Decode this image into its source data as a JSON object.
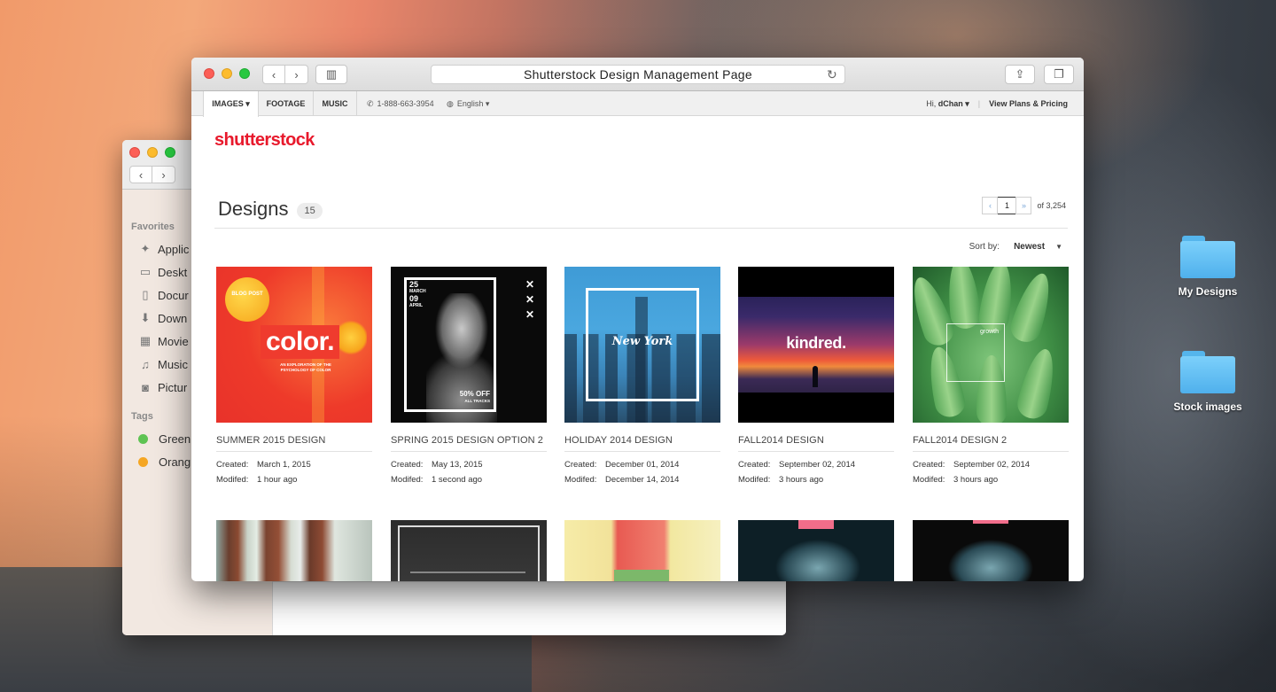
{
  "desktop": {
    "folders": [
      {
        "label": "My Designs"
      },
      {
        "label": "Stock images"
      }
    ]
  },
  "finder": {
    "sidebar": {
      "favorites_header": "Favorites",
      "favorites": [
        {
          "label": "Applic",
          "icon": "applications-icon"
        },
        {
          "label": "Deskt",
          "icon": "desktop-icon"
        },
        {
          "label": "Docur",
          "icon": "documents-icon"
        },
        {
          "label": "Down",
          "icon": "downloads-icon"
        },
        {
          "label": "Movie",
          "icon": "movies-icon"
        },
        {
          "label": "Music",
          "icon": "music-icon"
        },
        {
          "label": "Pictur",
          "icon": "pictures-icon"
        }
      ],
      "tags_header": "Tags",
      "tags": [
        {
          "label": "Green",
          "color": "#5ec352"
        },
        {
          "label": "Orang",
          "color": "#f5a623"
        }
      ]
    }
  },
  "browser": {
    "title": "Shutterstock Design Management Page"
  },
  "nav": {
    "tabs": [
      {
        "label": "IMAGES ▾",
        "active": true
      },
      {
        "label": "FOOTAGE",
        "active": false
      },
      {
        "label": "MUSIC",
        "active": false
      }
    ],
    "phone": "1-888-663-3954",
    "language": "English ▾",
    "greeting_prefix": "Hi,",
    "username": "dChan ▾",
    "divider": "|",
    "plans_link": "View Plans & Pricing"
  },
  "brand": {
    "logo_text": "shutterstock",
    "color": "#e8192c"
  },
  "main": {
    "title": "Designs",
    "count": "15",
    "pager": {
      "prev": "‹",
      "current_page": "1",
      "next": "»",
      "total_label": "of 3,254"
    },
    "sort": {
      "label": "Sort by:",
      "value": "Newest"
    },
    "created_label": "Created:",
    "modified_label": "Modifed:",
    "designs": [
      {
        "title": "SUMMER 2015 DESIGN",
        "created": "March 1, 2015",
        "modified": "1 hour ago",
        "thumb": {
          "badge": "BLOG POST",
          "word": "color.",
          "sub": "AN EXPLORATION OF THE PSYCHOLOGY OF COLOR"
        }
      },
      {
        "title": "SPRING 2015 DESIGN OPTION 2",
        "created": "May 13, 2015",
        "modified": "1 second ago",
        "thumb": {
          "day1": "25",
          "month1": "MARCH",
          "day2": "09",
          "month2": "APRIL",
          "offer": "50% OFF",
          "offer_sub": "ALL TRACKS",
          "marks": "✕ ✕ ✕"
        }
      },
      {
        "title": "HOLIDAY 2014 DESIGN",
        "created": "December 01, 2014",
        "modified": "December 14, 2014",
        "thumb": {
          "word": "New York"
        }
      },
      {
        "title": "FALL2014 DESIGN",
        "created": "September 02, 2014",
        "modified": "3 hours ago",
        "thumb": {
          "word": "kindred."
        }
      },
      {
        "title": "FALL2014 DESIGN 2",
        "created": "September 02, 2014",
        "modified": "3 hours ago",
        "thumb": {
          "word": "growth"
        }
      }
    ]
  }
}
